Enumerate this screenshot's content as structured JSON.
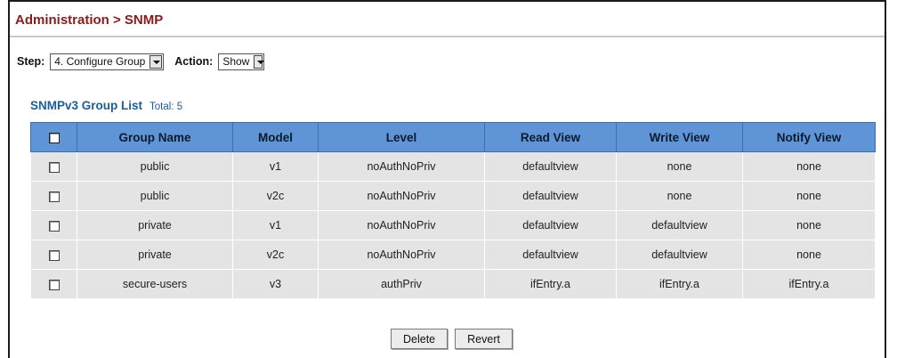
{
  "header": {
    "title": "Administration > SNMP"
  },
  "controls": {
    "step_label": "Step:",
    "step_value": "4. Configure Group",
    "action_label": "Action:",
    "action_value": "Show"
  },
  "group_list": {
    "title": "SNMPv3 Group List",
    "total": "Total: 5",
    "columns": [
      "Group Name",
      "Model",
      "Level",
      "Read View",
      "Write View",
      "Notify View"
    ],
    "rows": [
      [
        "public",
        "v1",
        "noAuthNoPriv",
        "defaultview",
        "none",
        "none"
      ],
      [
        "public",
        "v2c",
        "noAuthNoPriv",
        "defaultview",
        "none",
        "none"
      ],
      [
        "private",
        "v1",
        "noAuthNoPriv",
        "defaultview",
        "defaultview",
        "none"
      ],
      [
        "private",
        "v2c",
        "noAuthNoPriv",
        "defaultview",
        "defaultview",
        "none"
      ],
      [
        "secure-users",
        "v3",
        "authPriv",
        "ifEntry.a",
        "ifEntry.a",
        "ifEntry.a"
      ]
    ]
  },
  "buttons": {
    "delete": "Delete",
    "revert": "Revert"
  },
  "colors": {
    "title": "#8b1a1a",
    "list_title": "#1b5e9e",
    "header_bg": "#5f95d6",
    "row_bg": "#e4e4e4"
  }
}
